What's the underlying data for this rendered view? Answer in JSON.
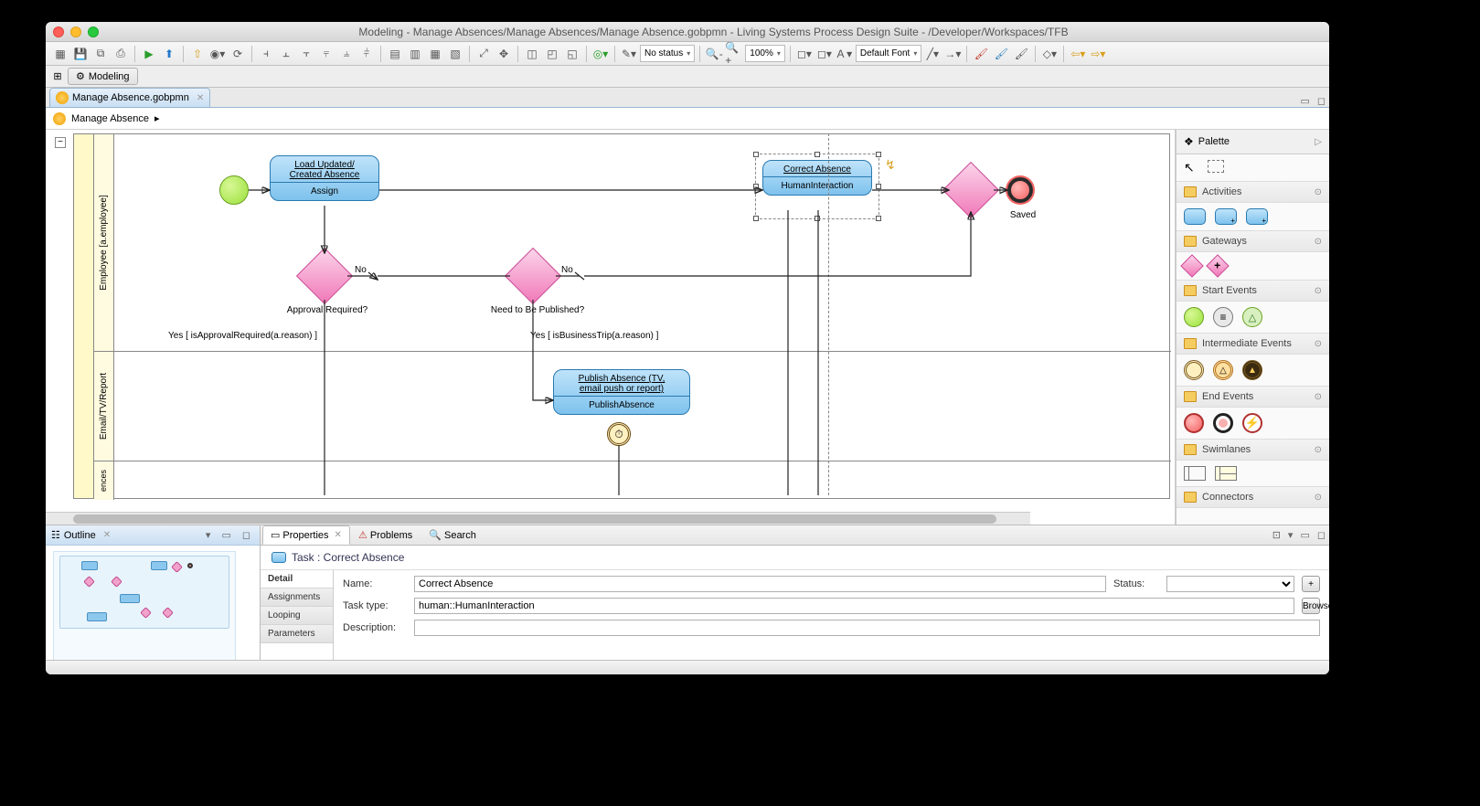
{
  "window": {
    "title": "Modeling - Manage Absences/Manage Absences/Manage Absence.gobpmn - Living Systems Process Design Suite - /Developer/Workspaces/TFB"
  },
  "toolbar": {
    "status_dd": "No status",
    "zoom": "100%",
    "font": "Default Font"
  },
  "perspective": {
    "modeling": "Modeling"
  },
  "editor_tab": {
    "name": "Manage Absence.gobpmn"
  },
  "breadcrumb": {
    "path": "Manage Absence",
    "chev": "▸"
  },
  "lanes": {
    "lane1": "Employee\n[a.employee]",
    "lane2": "Email/TV/Report",
    "lane3": "ences"
  },
  "diagram": {
    "task_load": {
      "title": "Load Updated/\nCreated Absence",
      "sub": "Assign"
    },
    "task_correct": {
      "title": "Correct Absence",
      "sub": "HumanInteraction"
    },
    "task_publish": {
      "title": "Publish Absence (TV,\nemail push or report)",
      "sub": "PublishAbsence"
    },
    "gw1_label": "Approval Required?",
    "gw2_label": "Need to Be Published?",
    "no1": "No",
    "no2": "No",
    "yes1": "Yes [  isApprovalRequired(a.reason)    ]",
    "yes2": "Yes [  isBusinessTrip(a.reason)    ]",
    "end_label": "Saved"
  },
  "palette": {
    "title": "Palette",
    "drawers": {
      "activities": "Activities",
      "gateways": "Gateways",
      "start": "Start Events",
      "intermediate": "Intermediate Events",
      "end": "End Events",
      "swimlanes": "Swimlanes",
      "connectors": "Connectors"
    }
  },
  "outline": {
    "title": "Outline"
  },
  "properties": {
    "tabs": {
      "properties": "Properties",
      "problems": "Problems",
      "search": "Search"
    },
    "header": "Task : Correct Absence",
    "side": {
      "detail": "Detail",
      "assignments": "Assignments",
      "looping": "Looping",
      "parameters": "Parameters"
    },
    "name_label": "Name:",
    "name_value": "Correct Absence",
    "status_label": "Status:",
    "tasktype_label": "Task type:",
    "tasktype_value": "human::HumanInteraction",
    "browse": "Browse...",
    "desc_label": "Description:",
    "plus": "+"
  }
}
